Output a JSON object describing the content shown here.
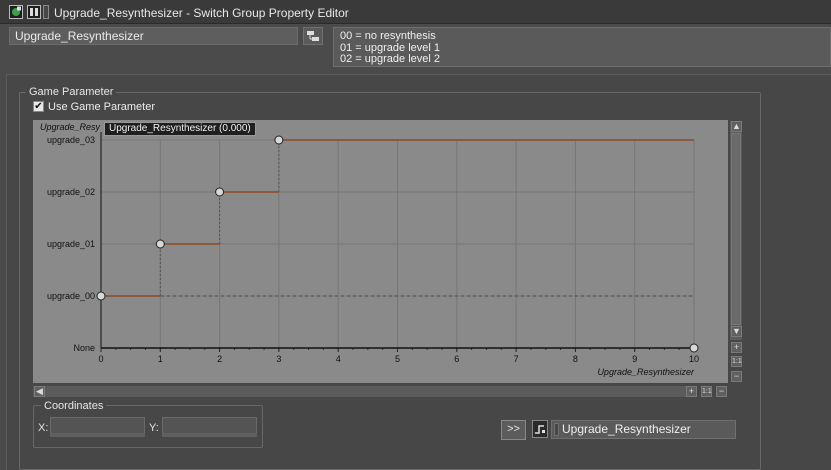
{
  "window": {
    "title": "Upgrade_Resynthesizer - Switch Group Property Editor"
  },
  "header": {
    "name_value": "Upgrade_Resynthesizer",
    "notes_lines": [
      "00 = no resynthesis",
      "01 = upgrade level 1",
      "02 = upgrade level 2"
    ]
  },
  "game_parameter": {
    "group_label": "Game Parameter",
    "use_checkbox_label": "Use Game Parameter",
    "use_checked": true,
    "checkmark": "✔"
  },
  "graph": {
    "tooltip": "Upgrade_Resynthesizer (0.000)",
    "y_axis_title": "Upgrade_Resy",
    "x_axis_title": "Upgrade_Resynthesizer",
    "background_color": "#8a8a8a",
    "curve_color": "#8a5a3a"
  },
  "chart_data": {
    "type": "line",
    "step": true,
    "x_label": "Upgrade_Resynthesizer",
    "y_label": "Upgrade_Resy",
    "xlim": [
      0,
      10
    ],
    "x_ticks": [
      "0",
      "1",
      "2",
      "3",
      "4",
      "5",
      "6",
      "7",
      "8",
      "9",
      "10"
    ],
    "y_categories": [
      "None",
      "upgrade_00",
      "upgrade_01",
      "upgrade_02",
      "upgrade_03"
    ],
    "points": [
      {
        "x": 0,
        "y": "upgrade_00"
      },
      {
        "x": 1,
        "y": "upgrade_01"
      },
      {
        "x": 2,
        "y": "upgrade_02"
      },
      {
        "x": 3,
        "y": "upgrade_03"
      },
      {
        "x": 10,
        "y": "None"
      }
    ],
    "grid": true
  },
  "scroll_controls": {
    "up": "▲",
    "down": "▼",
    "left": "◀",
    "zoom_in": "+",
    "zoom_fit": "1:1",
    "zoom_out": "−"
  },
  "coordinates": {
    "group_label": "Coordinates",
    "x_label": "X:",
    "y_label": "Y:"
  },
  "footer": {
    "next_button": ">>",
    "selected_parameter": "Upgrade_Resynthesizer"
  }
}
